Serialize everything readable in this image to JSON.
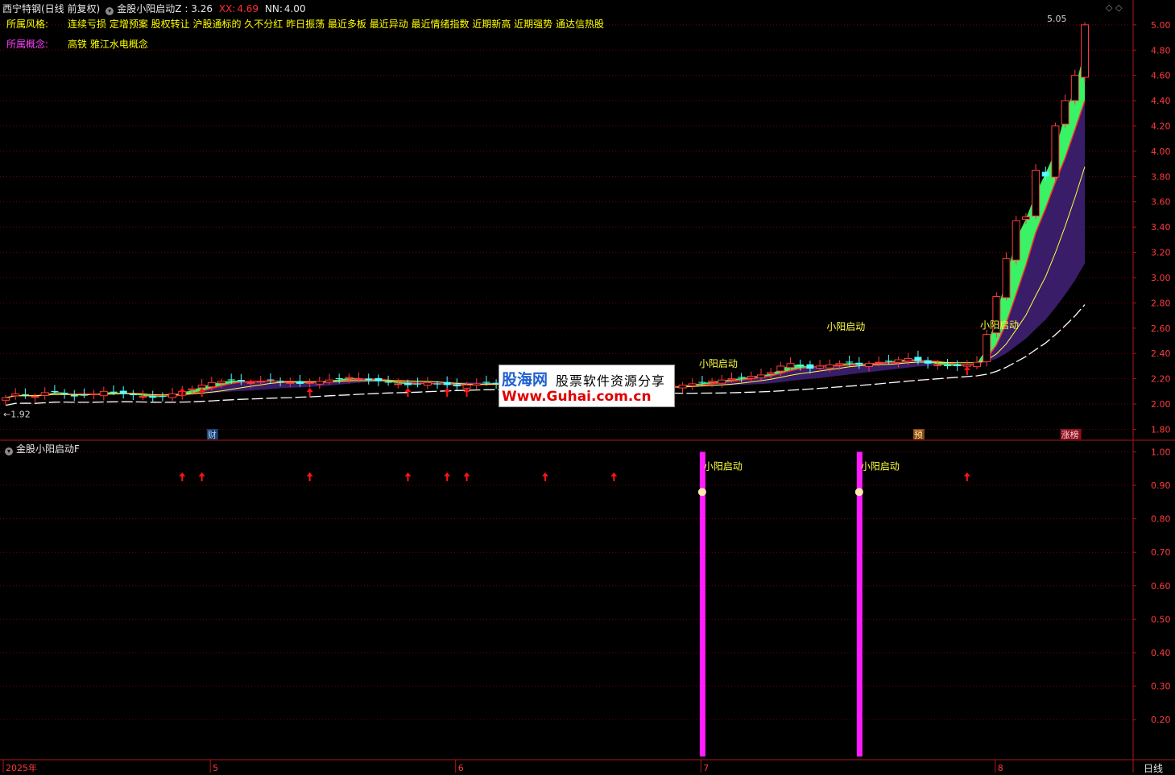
{
  "header": {
    "stock_name": "西宁特钢(日线 前复权)",
    "indicator_main": "金股小阳启动Z",
    "z_value": ": 3.26",
    "xx_label": "XX:",
    "xx_value": "4.69",
    "nn_label": "NN:",
    "nn_value": "4.00",
    "style_label": "所属风格:",
    "style_value": "连续亏损 定增预案 股权转让 沪股通标的 久不分红 昨日振荡 最近多板 最近异动 最近情绪指数 近期新高 近期强势 通达信热股",
    "concept_label": "所属概念:",
    "concept_value": "高铁 雅江水电概念"
  },
  "lower_panel": {
    "title": "金股小阳启动F"
  },
  "watermark": {
    "brand": "股海网",
    "slogan": "股票软件资源分享",
    "url": "Www.Guhai.com.cn"
  },
  "period_label": "日线",
  "colors": {
    "up": "#ff3b3b",
    "down": "#54ffff",
    "grid": "#7a0000",
    "axis": "#b01818",
    "ribbon_bull": "#3cff6a",
    "ribbon_band": "#3c1f6e",
    "signal_bar": "#ff1cff",
    "signal_text": "#ffff40",
    "arrow": "#ff1414"
  },
  "chart_data": [
    {
      "type": "candlestick",
      "y_axis_ticks": [
        "5.00",
        "4.80",
        "4.60",
        "4.40",
        "4.20",
        "4.00",
        "3.80",
        "3.60",
        "3.40",
        "3.20",
        "3.00",
        "2.80",
        "2.60",
        "2.40",
        "2.20",
        "2.00",
        "1.80"
      ],
      "ylim": [
        1.72,
        5.12
      ],
      "x_labels": [
        "2025年",
        "5",
        "6",
        "7",
        "8"
      ],
      "high_label": "5.05",
      "low_label": "1.92",
      "event_tags": [
        "财",
        "预",
        "涨榜"
      ],
      "signal_labels": [
        "小阳启动",
        "小阳启动",
        "小阳启动"
      ],
      "series": [
        {
          "name": "price",
          "closes": [
            2.05,
            2.08,
            2.07,
            2.06,
            2.09,
            2.1,
            2.08,
            2.06,
            2.07,
            2.08,
            2.1,
            2.09,
            2.08,
            2.07,
            2.06,
            2.05,
            2.06,
            2.08,
            2.1,
            2.12,
            2.15,
            2.17,
            2.18,
            2.19,
            2.18,
            2.17,
            2.18,
            2.19,
            2.18,
            2.17,
            2.16,
            2.17,
            2.18,
            2.19,
            2.2,
            2.21,
            2.2,
            2.19,
            2.18,
            2.17,
            2.16,
            2.15,
            2.16,
            2.17,
            2.16,
            2.15,
            2.14,
            2.15,
            2.16,
            2.17,
            2.16,
            2.15,
            2.14,
            2.13,
            2.14,
            2.15,
            2.16,
            2.15,
            2.14,
            2.13,
            2.12,
            2.13,
            2.14,
            2.15,
            2.14,
            2.13,
            2.12,
            2.13,
            2.14,
            2.15,
            2.16,
            2.17,
            2.18,
            2.19,
            2.2,
            2.21,
            2.22,
            2.23,
            2.25,
            2.3,
            2.32,
            2.3,
            2.28,
            2.3,
            2.31,
            2.32,
            2.33,
            2.31,
            2.32,
            2.33,
            2.34,
            2.35,
            2.36,
            2.34,
            2.32,
            2.31,
            2.3,
            2.3,
            2.31,
            2.33,
            2.55,
            2.85,
            3.15,
            3.45,
            3.48,
            3.85,
            3.8,
            4.2,
            4.4,
            4.6,
            5.0
          ]
        },
        {
          "name": "XX",
          "final_value": 4.69
        },
        {
          "name": "NN",
          "final_value": 4.0
        }
      ]
    },
    {
      "type": "bar",
      "y_axis_ticks": [
        "1.00",
        "0.90",
        "0.80",
        "0.70",
        "0.60",
        "0.50",
        "0.40",
        "0.30",
        "0.20"
      ],
      "ylim": [
        0.08,
        1.03
      ],
      "signals": [
        {
          "index": 71,
          "value": 1.0,
          "label": "小阳启动"
        },
        {
          "index": 87,
          "value": 1.0,
          "label": "小阳启动"
        }
      ],
      "arrow_indices": [
        18,
        20,
        31,
        41,
        45,
        47,
        55,
        62
      ]
    }
  ]
}
